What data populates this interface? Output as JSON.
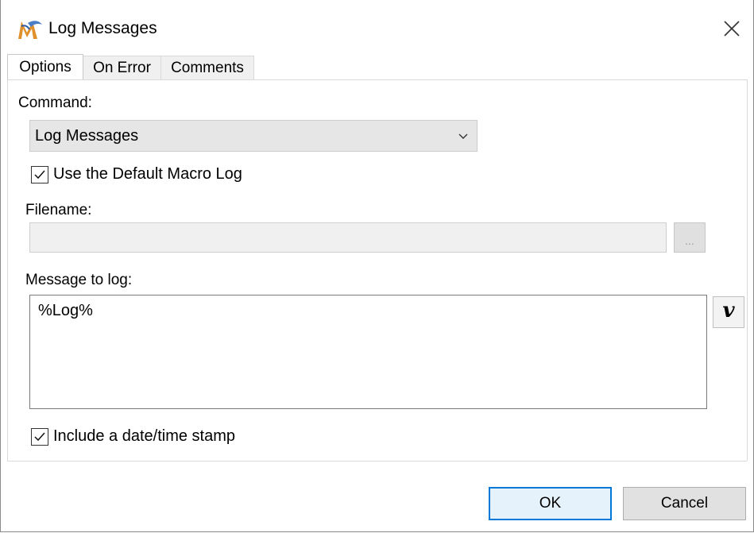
{
  "window": {
    "title": "Log Messages"
  },
  "tabs": [
    {
      "label": "Options",
      "active": true
    },
    {
      "label": "On Error",
      "active": false
    },
    {
      "label": "Comments",
      "active": false
    }
  ],
  "options": {
    "command_label": "Command:",
    "command_value": "Log Messages",
    "use_default_log": {
      "label": "Use the Default Macro Log",
      "checked": true
    },
    "filename_label": "Filename:",
    "filename_value": "",
    "browse_label": "...",
    "message_label": "Message to log:",
    "message_value": "%Log%",
    "variable_button_label": "v",
    "timestamp": {
      "label": "Include a date/time stamp",
      "checked": true
    }
  },
  "buttons": {
    "ok": "OK",
    "cancel": "Cancel"
  },
  "icons": {
    "app": "keyboard-maestro-icon",
    "close": "close-icon",
    "dropdown": "chevron-down-icon",
    "check": "checkmark-icon"
  },
  "colors": {
    "accent": "#0078d7",
    "ok_bg": "#e5f1fb"
  }
}
